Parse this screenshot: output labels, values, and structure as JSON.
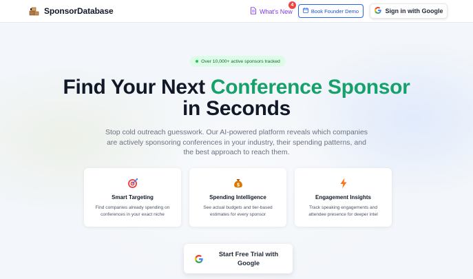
{
  "brand": {
    "name": "SponsorDatabase",
    "logo_icon": "boxes-stack-icon"
  },
  "nav": {
    "whats_new": {
      "label": "What's New",
      "icon": "document-icon",
      "badge_count": "4",
      "color": "#7c3aed"
    },
    "demo": {
      "label": "Book Founder Demo",
      "icon": "calendar-icon",
      "color": "#2563eb"
    },
    "signin": {
      "label": "Sign in with Google",
      "icon": "google-icon"
    }
  },
  "hero": {
    "pill": "Over 10,000+ active sponsors tracked",
    "headline_part1": "Find Your Next ",
    "headline_accent": "Conference Sponsor",
    "headline_part2": "in Seconds",
    "accent_color": "#16a06a",
    "subtitle": "Stop cold outreach guesswork. Our AI-powered platform reveals which companies are actively sponsoring conferences in your industry, their spending patterns, and the best approach to reach them."
  },
  "features": [
    {
      "icon": "target-icon",
      "title": "Smart Targeting",
      "desc": "Find companies already spending on conferences in your exact niche"
    },
    {
      "icon": "money-bag-icon",
      "title": "Spending Intelligence",
      "desc": "See actual budgets and tier-based estimates for every sponsor"
    },
    {
      "icon": "lightning-icon",
      "title": "Engagement Insights",
      "desc": "Track speaking engagements and attendee presence for deeper intel"
    }
  ],
  "cta": {
    "label": "Start Free Trial with Google",
    "icon": "google-icon"
  }
}
